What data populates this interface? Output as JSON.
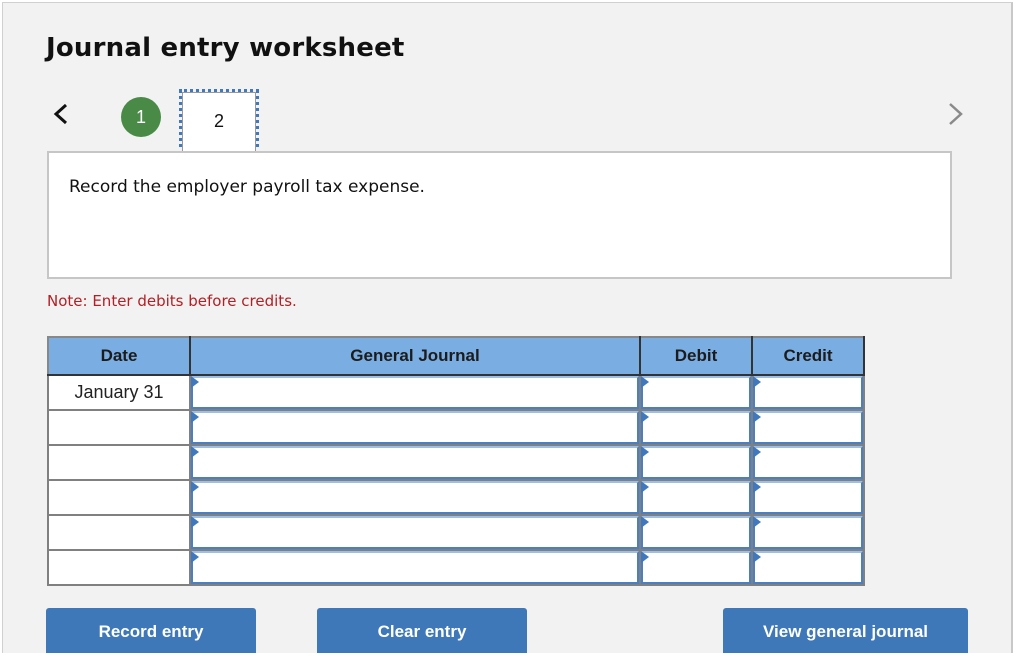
{
  "title": "Journal entry worksheet",
  "navigation": {
    "prev_icon": "chevron-left-icon",
    "next_icon": "chevron-right-icon",
    "steps": [
      {
        "label": "1",
        "state": "completed"
      },
      {
        "label": "2",
        "state": "current"
      }
    ]
  },
  "prompt": "Record the employer payroll tax expense.",
  "note": "Note: Enter debits before credits.",
  "table": {
    "headers": [
      "Date",
      "General Journal",
      "Debit",
      "Credit"
    ],
    "rows": [
      {
        "date": "January 31",
        "account": "",
        "debit": "",
        "credit": ""
      },
      {
        "date": "",
        "account": "",
        "debit": "",
        "credit": ""
      },
      {
        "date": "",
        "account": "",
        "debit": "",
        "credit": ""
      },
      {
        "date": "",
        "account": "",
        "debit": "",
        "credit": ""
      },
      {
        "date": "",
        "account": "",
        "debit": "",
        "credit": ""
      },
      {
        "date": "",
        "account": "",
        "debit": "",
        "credit": ""
      }
    ]
  },
  "buttons": {
    "record": "Record entry",
    "clear": "Clear entry",
    "view": "View general journal"
  },
  "colors": {
    "step_completed": "#4a8a47",
    "header_bg": "#7aaee3",
    "button_bg": "#3e78b8",
    "note_text": "#b21f24"
  }
}
